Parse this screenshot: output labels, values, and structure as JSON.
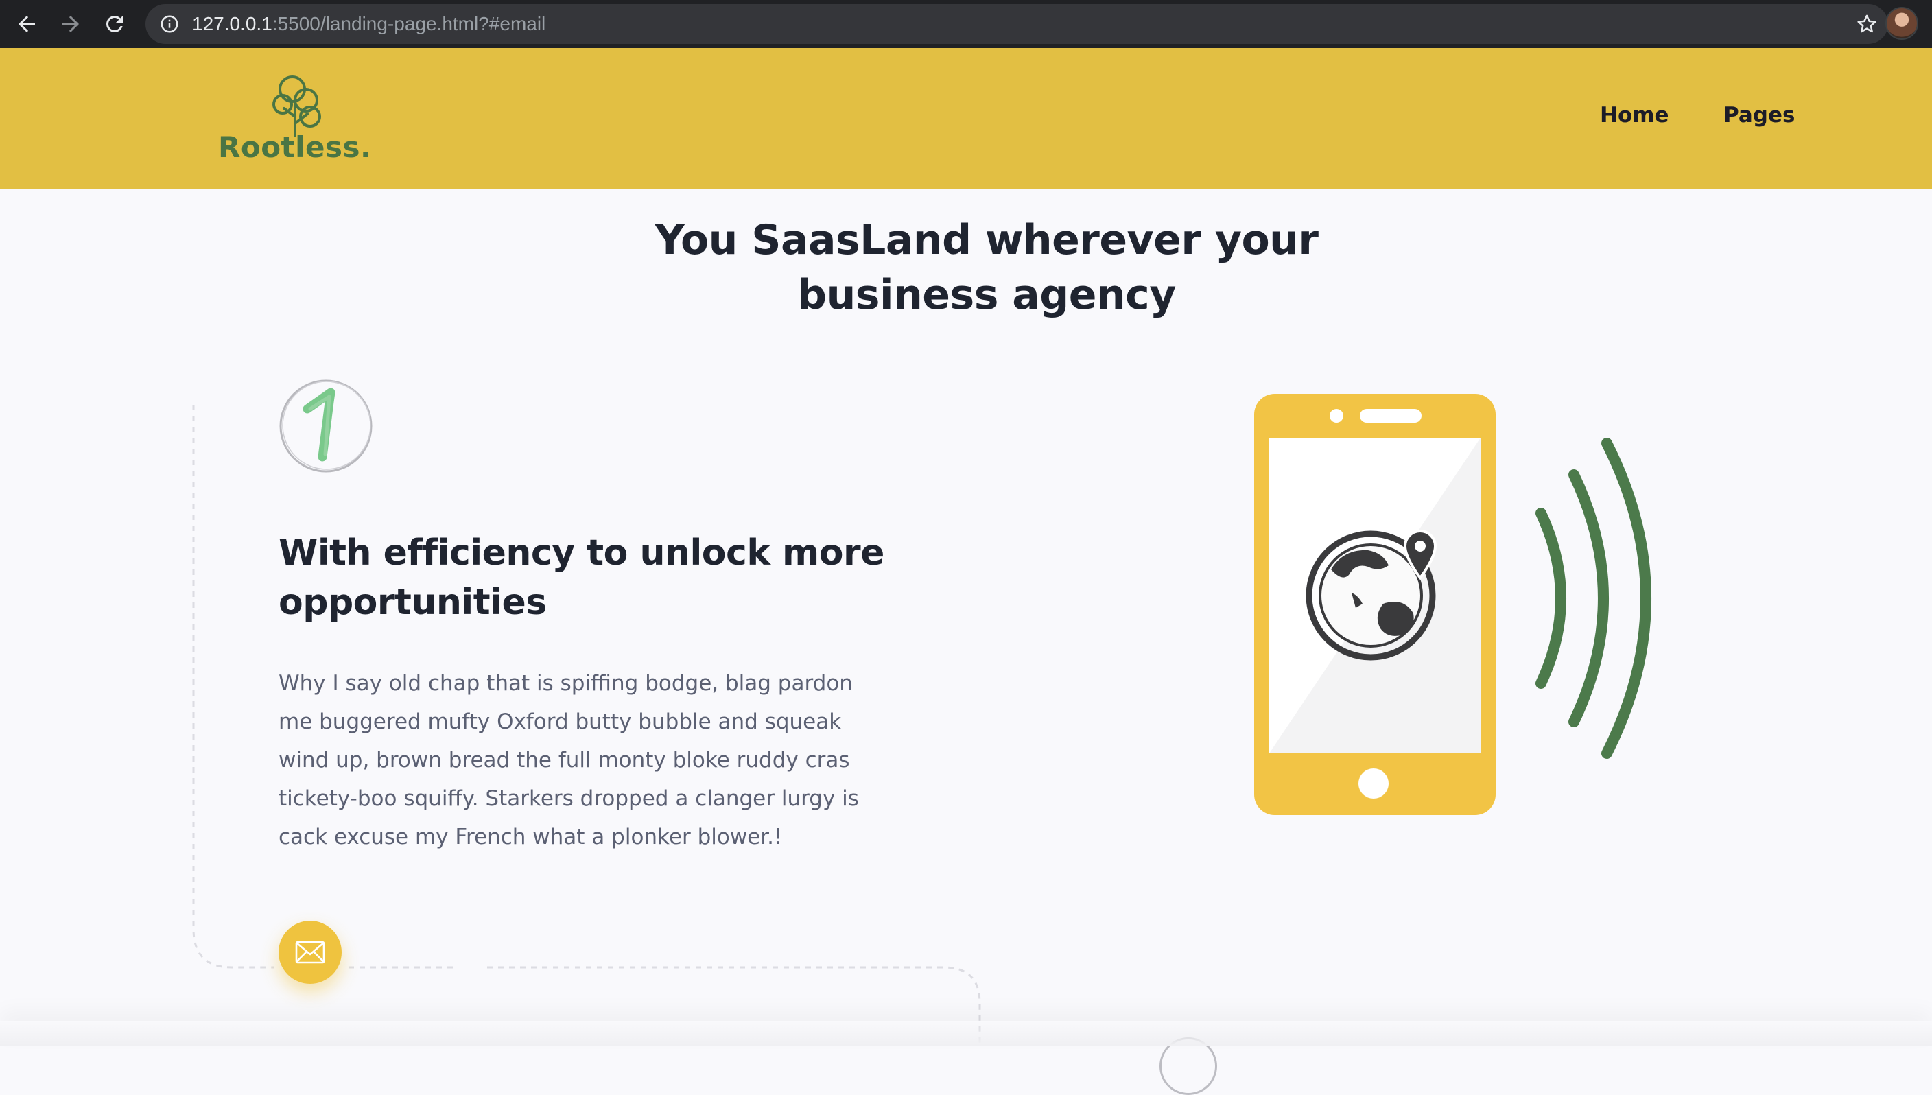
{
  "browser": {
    "url_host": "127.0.0.1",
    "url_rest": ":5500/landing-page.html?#email",
    "icons": [
      "back-arrow-icon",
      "forward-arrow-icon",
      "reload-icon",
      "info-icon",
      "star-icon"
    ]
  },
  "header": {
    "logo_text": "Rootless.",
    "nav": [
      {
        "label": "Home"
      },
      {
        "label": "Pages"
      }
    ]
  },
  "hero": {
    "title_line1": "You SaasLand wherever your",
    "title_line2": "business agency"
  },
  "feature": {
    "step_number": "1",
    "title_line1": "With efficiency to unlock more",
    "title_line2": "opportunities",
    "text": "Why I say old chap that is spiffing bodge, blag pardon me buggered mufty Oxford butty bubble and squeak wind up, brown bread the full monty bloke ruddy cras tickety-boo squiffy. Starkers dropped a clanger lurgy is cack excuse my French what a plonker blower.!"
  },
  "colors": {
    "header_bg": "#e2bf43",
    "accent_yellow": "#efc33f",
    "phone_yellow": "#f2c445",
    "wave_green": "#4c7a4b",
    "step_number_green": "#6cc37e",
    "title_text": "#1f2430",
    "body_text": "#5b6073"
  }
}
